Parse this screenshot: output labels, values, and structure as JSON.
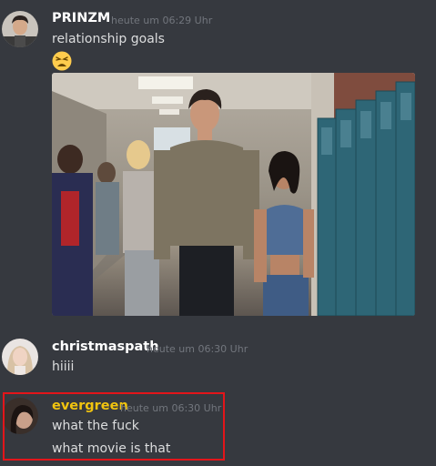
{
  "messages": [
    {
      "username": "PRINZM",
      "username_color": "#ffffff",
      "timestamp": "heute um 06:29 Uhr",
      "lines": [
        "relationship goals"
      ],
      "emoji": "tired-face-emoji",
      "attachment": "image-attachment"
    },
    {
      "username": "christmaspath",
      "username_color": "#ffffff",
      "timestamp": "heute um 06:30 Uhr",
      "lines": [
        "hiiii"
      ]
    },
    {
      "username": "evergreen",
      "username_color": "#f1c40f",
      "timestamp": "heute um 06:30 Uhr",
      "lines": [
        "what the fuck",
        "what movie is that"
      ]
    }
  ],
  "colors": {
    "background": "#36393f",
    "timestamp": "#72767d",
    "highlight_border": "#e3151a"
  }
}
